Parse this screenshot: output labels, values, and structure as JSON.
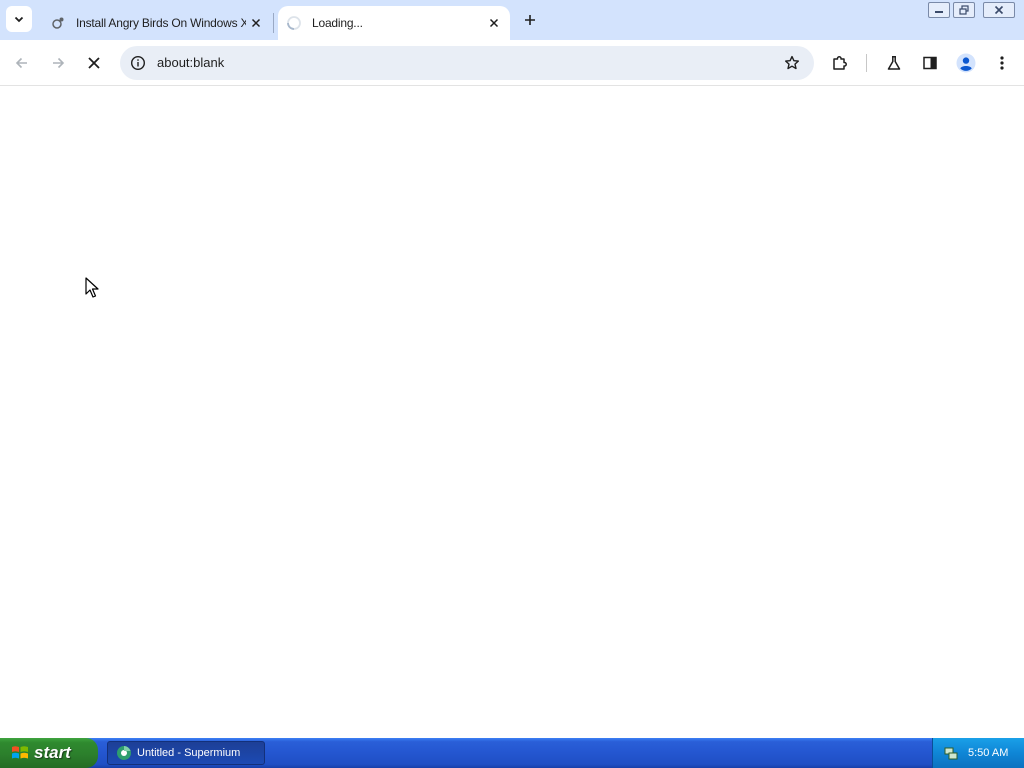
{
  "browser": {
    "tabs": [
      {
        "title": "Install Angry Birds On Windows XP",
        "state": "inactive"
      },
      {
        "title": "Loading...",
        "state": "active"
      }
    ],
    "address_bar": {
      "url": "about:blank"
    }
  },
  "taskbar": {
    "start_label": "start",
    "task_item_label": "Untitled - Supermium",
    "clock": "5:50 AM"
  },
  "colors": {
    "tabstrip_bg": "#d3e3fd",
    "omnibox_bg": "#e9eef6",
    "taskbar_blue": "#2456d0",
    "start_green": "#2f8a2f"
  }
}
